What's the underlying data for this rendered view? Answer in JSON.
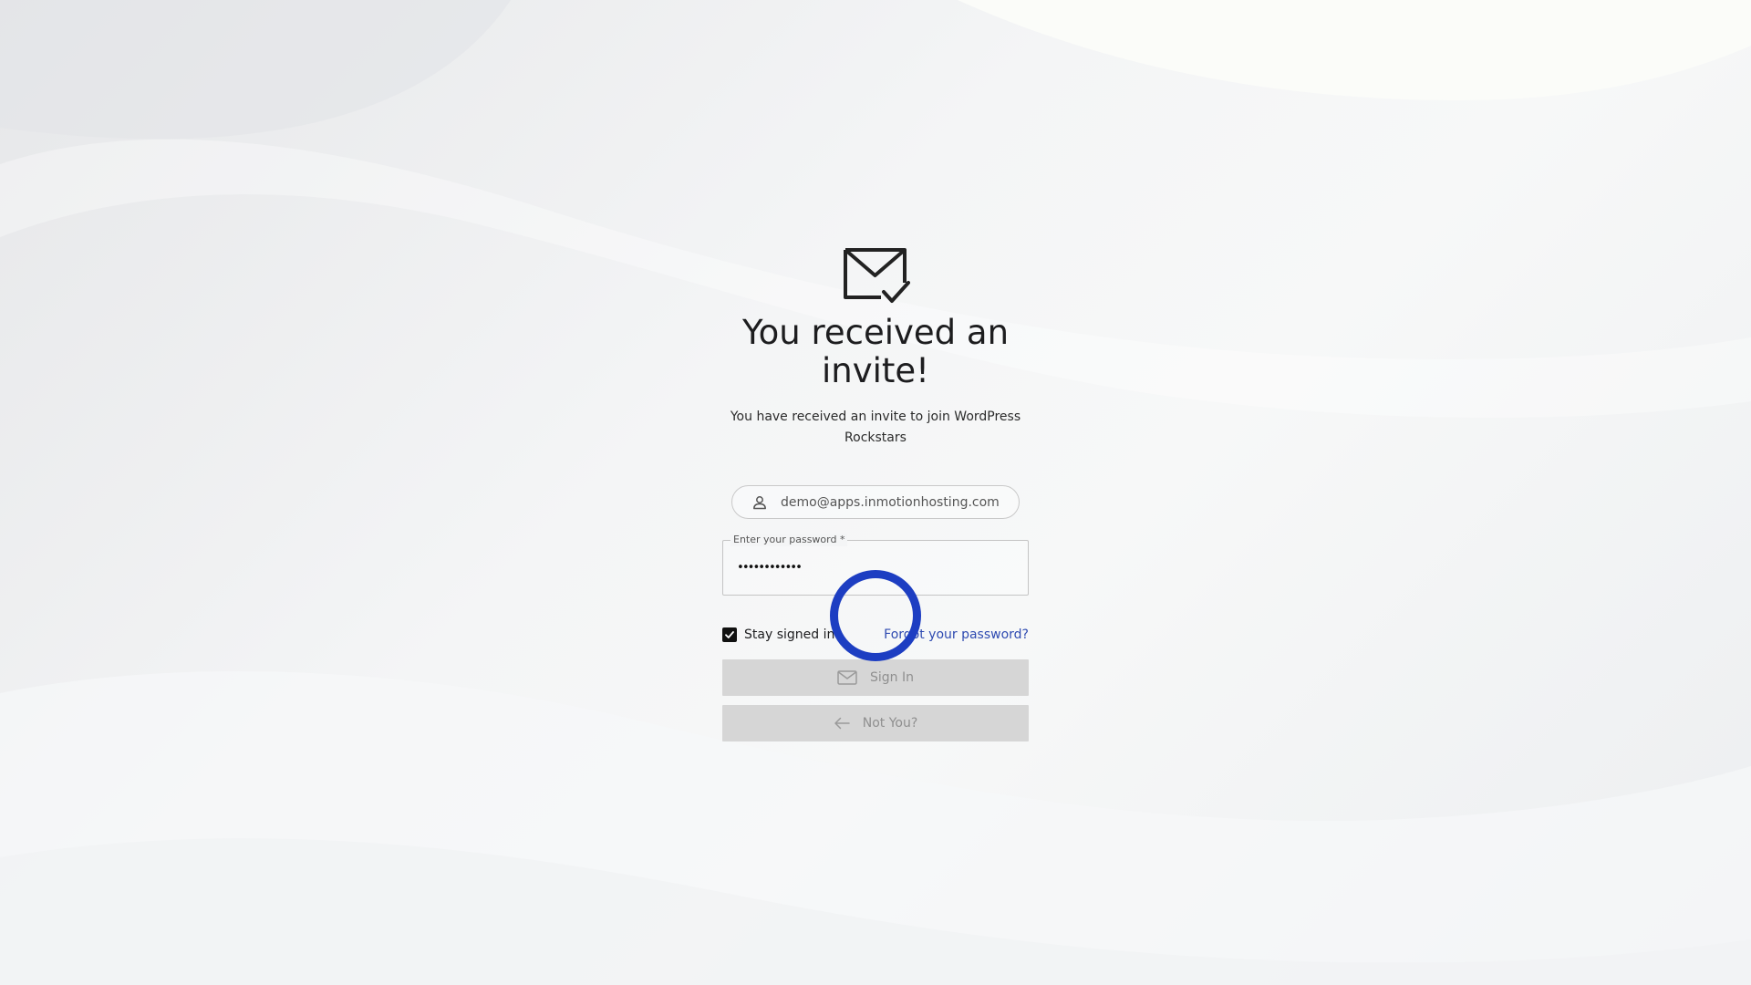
{
  "page": {
    "title": "You received an invite!",
    "subtitle": "You have received an invite to join WordPress Rockstars"
  },
  "account": {
    "email": "demo@apps.inmotionhosting.com"
  },
  "password": {
    "label": "Enter your password *",
    "value": "••••••••••••"
  },
  "options": {
    "stay_signed_in_label": "Stay signed in",
    "stay_signed_in_checked": true,
    "forgot_password_label": "Forgot your password?"
  },
  "buttons": {
    "sign_in_label": "Sign In",
    "not_you_label": "Not You?"
  },
  "icons": {
    "header": "mail-check-icon",
    "email_prefix": "user-icon",
    "sign_in": "mail-icon",
    "not_you": "arrow-left-icon"
  },
  "colors": {
    "link": "#2f4bb1",
    "button_bg": "#d6d6d6",
    "button_text": "#8f8f8f",
    "cursor_ring": "#1d3ec2"
  }
}
